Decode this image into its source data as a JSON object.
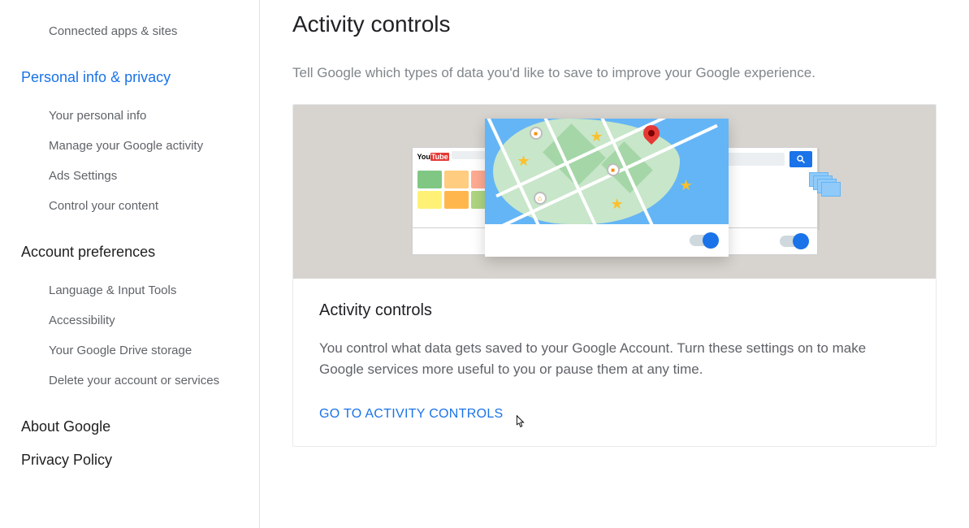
{
  "sidebar": {
    "top_items": [
      {
        "label": "Connected apps & sites"
      }
    ],
    "sections": [
      {
        "heading": "Personal info & privacy",
        "active": true,
        "items": [
          {
            "label": "Your personal info"
          },
          {
            "label": "Manage your Google activity"
          },
          {
            "label": "Ads Settings"
          },
          {
            "label": "Control your content"
          }
        ]
      },
      {
        "heading": "Account preferences",
        "active": false,
        "items": [
          {
            "label": "Language & Input Tools"
          },
          {
            "label": "Accessibility"
          },
          {
            "label": "Your Google Drive storage"
          },
          {
            "label": "Delete your account or services"
          }
        ]
      }
    ],
    "footer": [
      {
        "label": "About Google"
      },
      {
        "label": "Privacy Policy"
      }
    ]
  },
  "main": {
    "title": "Activity controls",
    "subtitle": "Tell Google which types of data you'd like to save to improve your Google experience.",
    "card": {
      "title": "Activity controls",
      "text": "You control what data gets saved to your Google Account. Turn these settings on to make Google services more useful to you or pause them at any time.",
      "link": "GO TO ACTIVITY CONTROLS"
    },
    "illustration": {
      "youtube_label": "YouTube"
    }
  }
}
